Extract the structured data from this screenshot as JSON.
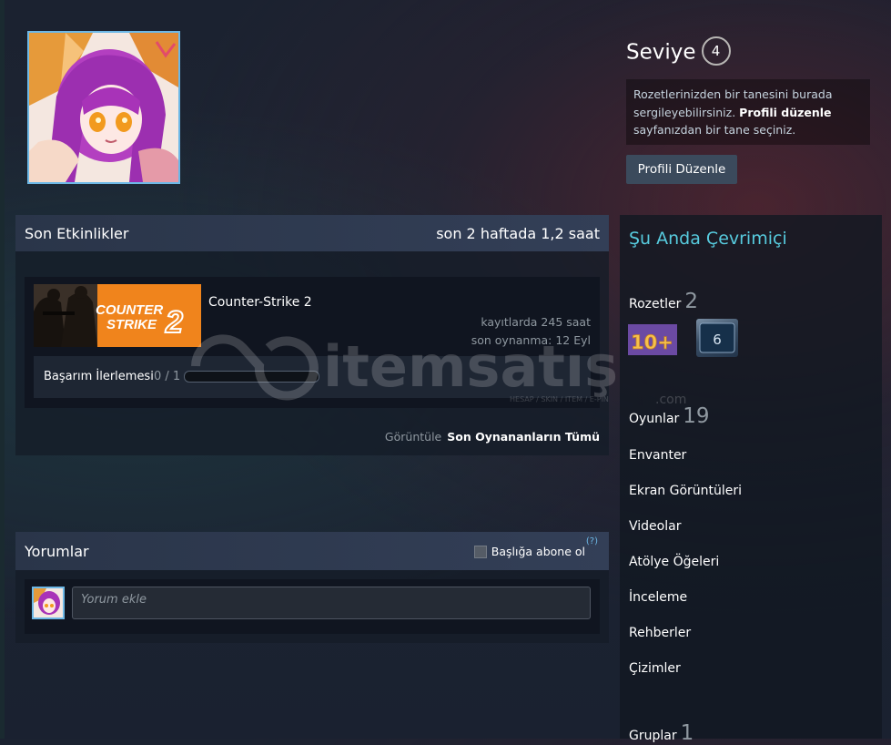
{
  "level": {
    "title": "Seviye",
    "value": "4"
  },
  "badge_tip": {
    "text1": "Rozetlerinizden bir tanesini burada sergileyebilirsiniz. ",
    "link": "Profili düzenle",
    "text2": " sayfanızdan bir tane seçiniz."
  },
  "edit_profile_button": "Profili Düzenle",
  "activity": {
    "title": "Son Etkinlikler",
    "summary": "son 2 haftada 1,2 saat",
    "game": {
      "name": "Counter-Strike 2",
      "capsule_line1": "COUNTER",
      "capsule_line2": "STRIKE",
      "capsule_num": "2",
      "hours_on_record": "kayıtlarda 245 saat",
      "last_played": "son oynanma: 12 Eyl",
      "achievement_label": "Başarım İlerlemesi",
      "achievement_count": "0 / 1",
      "achievement_progress": 0
    },
    "view_label": "Görüntüle",
    "view_all": "Son Oynananların Tümü"
  },
  "comments": {
    "title": "Yorumlar",
    "subscribe_label": "Başlığa abone ol",
    "help": "(?)",
    "input_placeholder": "Yorum ekle"
  },
  "sidebar": {
    "status": "Şu Anda Çevrimiçi",
    "badges_label": "Rozetler",
    "badges_count": "2",
    "badge_1_text": "10+",
    "badge_2_text": "6",
    "games_label": "Oyunlar",
    "games_count": "19",
    "links": [
      "Envanter",
      "Ekran Görüntüleri",
      "Videolar",
      "Atölye Öğeleri",
      "İnceleme",
      "Rehberler",
      "Çizimler"
    ],
    "groups_label": "Gruplar",
    "groups_count": "1"
  },
  "watermark": {
    "brand": "itemsatış",
    "tagline": "HESAP / SKIN / ITEM / E-PIN",
    "suffix": ".com"
  },
  "colors": {
    "accent": "#57cbde",
    "link_blue": "#6db8e6",
    "capsule_orange": "#f0841c"
  }
}
